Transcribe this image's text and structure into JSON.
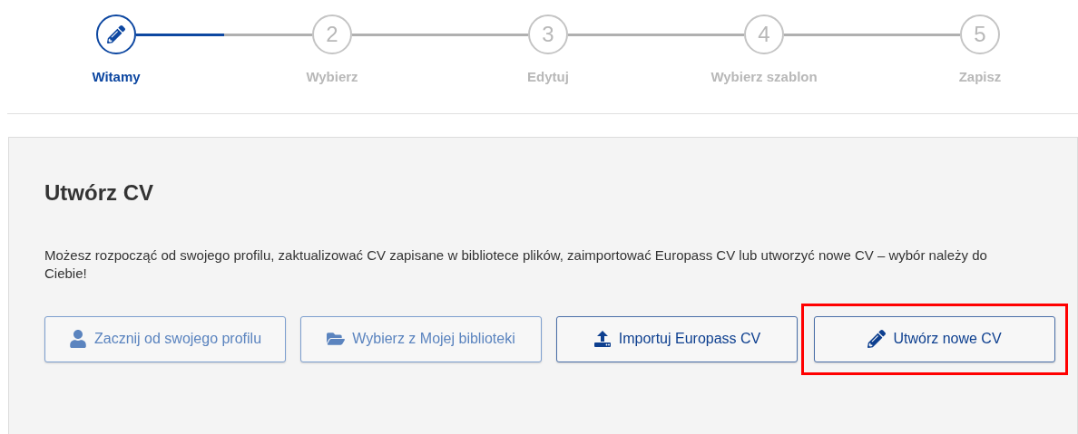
{
  "steps": [
    {
      "label": "Witamy",
      "selected": true
    },
    {
      "number": "2",
      "label": "Wybierz",
      "selected": false
    },
    {
      "number": "3",
      "label": "Edytuj",
      "selected": false
    },
    {
      "number": "4",
      "label": "Wybierz szablon",
      "selected": false
    },
    {
      "number": "5",
      "label": "Zapisz",
      "selected": false
    }
  ],
  "panel": {
    "title": "Utwórz CV",
    "description": "Możesz rozpocząć od swojego profilu, zaktualizować CV zapisane w bibliotece plików, zaimportować Europass CV lub utworzyć nowe CV – wybór należy do Ciebie!",
    "buttons": [
      {
        "kind": "profile",
        "label": "Zacznij od swojego profilu",
        "disabled": true,
        "highlighted": false
      },
      {
        "kind": "library",
        "label": "Wybierz z Mojej biblioteki",
        "disabled": true,
        "highlighted": false
      },
      {
        "kind": "import",
        "label": "Importuj Europass CV",
        "disabled": false,
        "highlighted": false
      },
      {
        "kind": "create",
        "label": "Utwórz nowe CV",
        "disabled": false,
        "highlighted": true
      }
    ]
  }
}
